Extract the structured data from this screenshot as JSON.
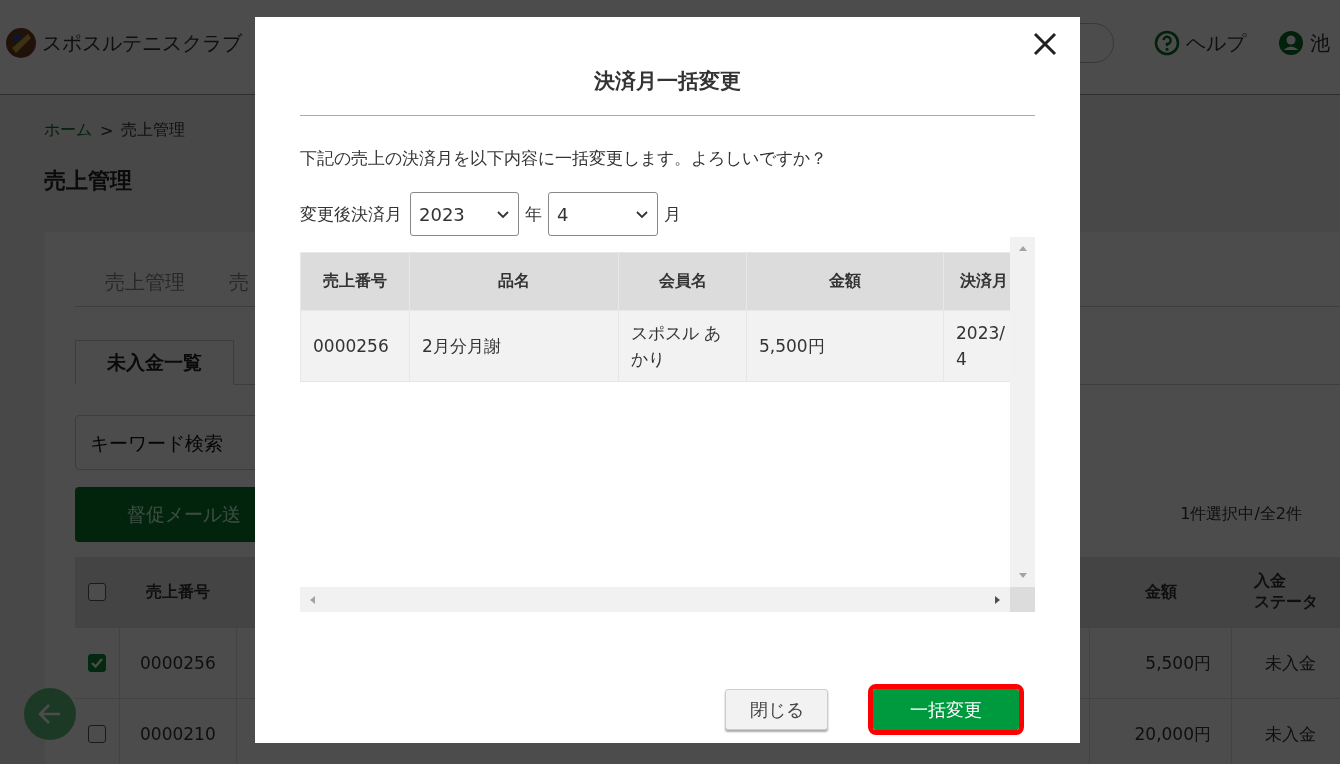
{
  "header": {
    "site_name": "スポスルテニスクラブ",
    "help": "ヘルプ",
    "user": "池"
  },
  "breadcrumb": [
    {
      "label": "ホーム",
      "kind": "link"
    },
    {
      "label": "売上管理",
      "kind": "current"
    }
  ],
  "breadcrumb_separator": ">",
  "page_title": "売上管理",
  "tabs": [
    {
      "label": "売上管理",
      "selected": false
    },
    {
      "label": "売",
      "selected": false
    }
  ],
  "sub_tabs": [
    {
      "label": "未入金一覧",
      "selected": true
    }
  ],
  "search": {
    "placeholder": "キーワード検索"
  },
  "reminder_button": "督促メール送",
  "selection_count": "1件選択中/全2件",
  "table": {
    "header_checked": false,
    "columns": [
      {
        "lines": [
          "売上番号"
        ]
      },
      {
        "lines": [
          "金額"
        ]
      },
      {
        "lines": [
          "入金",
          "ステータ"
        ]
      }
    ],
    "rows": [
      {
        "checked": true,
        "number": "0000256",
        "amount": "5,500円",
        "status": "未入金"
      },
      {
        "checked": false,
        "number": "0000210",
        "amount": "20,000円",
        "status": "未入金"
      }
    ]
  },
  "modal": {
    "title": "決済月一括変更",
    "message": "下記の売上の決済月を以下内容に一括変更します。よろしいですか？",
    "form": {
      "label": "変更後決済月",
      "year": "2023",
      "year_unit": "年",
      "month": "4",
      "month_unit": "月"
    },
    "table": {
      "columns": [
        "売上番号",
        "品名",
        "会員名",
        "金額",
        "決済月"
      ],
      "rows": [
        {
          "cells": [
            "0000256",
            "2月分月謝",
            "スポスル あかり",
            "5,500円",
            "2023/4"
          ]
        }
      ]
    },
    "buttons": [
      {
        "label": "閉じる",
        "kind": "secondary",
        "highlighted": false
      },
      {
        "label": "一括変更",
        "kind": "primary",
        "highlighted": true
      }
    ]
  }
}
